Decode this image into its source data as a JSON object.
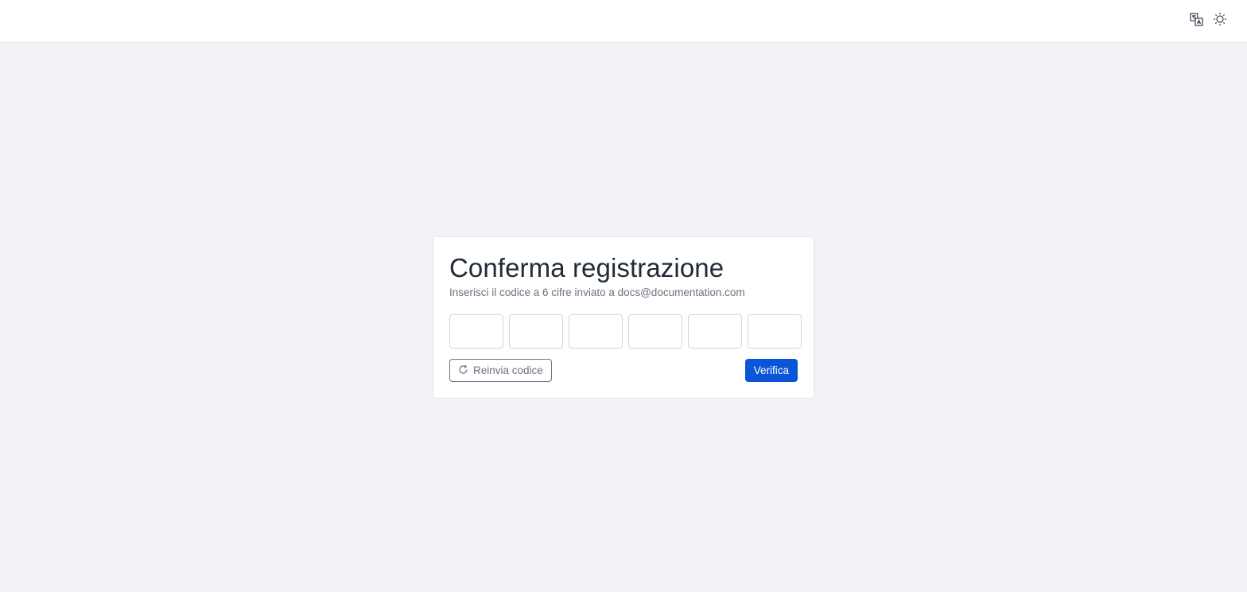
{
  "header": {
    "icons": [
      "translate-icon",
      "sun-icon"
    ]
  },
  "card": {
    "title": "Conferma registrazione",
    "subtitle": "Inserisci il codice a 6 cifre inviato a docs@documentation.com",
    "code_digits": [
      "",
      "",
      "",
      "",
      "",
      ""
    ],
    "resend_label": "Reinvia codice",
    "verify_label": "Verifica"
  },
  "colors": {
    "accent": "#0a55d8",
    "background": "#f1f3f6"
  }
}
